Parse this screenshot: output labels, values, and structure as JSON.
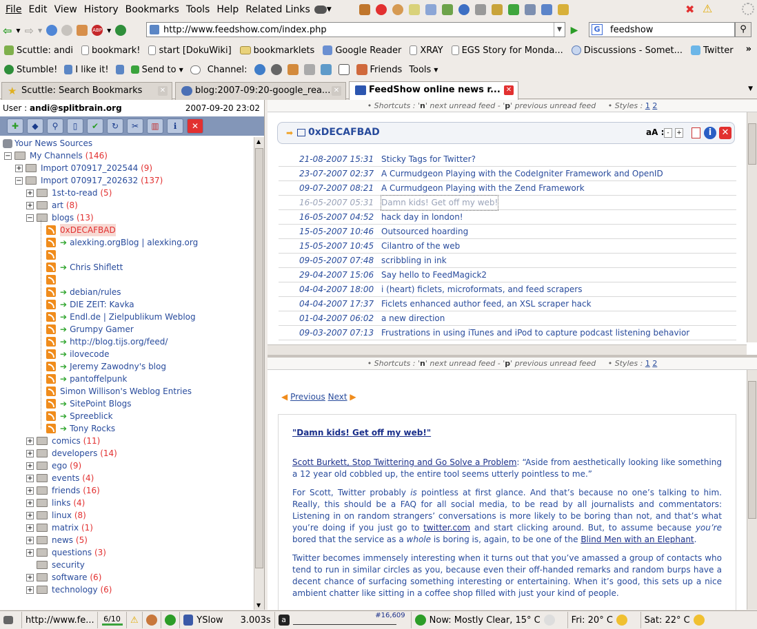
{
  "menu": [
    "File",
    "Edit",
    "View",
    "History",
    "Bookmarks",
    "Tools",
    "Help",
    "Related Links"
  ],
  "nav": {
    "url": "http://www.feedshow.com/index.php",
    "search": "feedshow"
  },
  "bookmarks": [
    "Scuttle: andi",
    "bookmark!",
    "start [DokuWiki]",
    "bookmarklets",
    "Google Reader",
    "XRAY",
    "EGS Story for Monda...",
    "Discussions - Somet...",
    "Twitter"
  ],
  "stumble": {
    "stumble": "Stumble!",
    "like": "I like it!",
    "send": "Send to",
    "channel": "Channel:",
    "friends": "Friends",
    "tools": "Tools"
  },
  "tabs": [
    "Scuttle: Search Bookmarks",
    "blog:2007-09:20-google_rea...",
    "FeedShow online news r..."
  ],
  "user": {
    "label": "User :",
    "name": "andi@splitbrain.org",
    "date": "2007-09-20 23:02"
  },
  "tree": {
    "root": "Your News Sources",
    "channels": {
      "name": "My Channels",
      "count": "(146)"
    },
    "imp1": {
      "name": "Import 070917_202544",
      "count": "(9)"
    },
    "imp2": {
      "name": "Import 070917_202632",
      "count": "(137)"
    },
    "first": {
      "name": "1st-to-read",
      "count": "(5)"
    },
    "art": {
      "name": "art",
      "count": "(8)"
    },
    "blogs": {
      "name": "blogs",
      "count": "(13)"
    },
    "feeds": [
      "0xDECAFBAD",
      "alexking.orgBlog | alexking.org",
      "",
      "Chris Shiflett",
      "",
      "debian/rules",
      "DIE ZEIT: Kavka",
      "Endl.de | Zielpublikum Weblog",
      "Grumpy Gamer",
      "http://blog.tijs.org/feed/",
      "ilovecode",
      "Jeremy Zawodny's blog",
      "pantoffelpunk",
      "Simon Willison's Weblog Entries",
      "SitePoint Blogs",
      "Spreeblick",
      "Tony Rocks"
    ],
    "folders": [
      {
        "name": "comics",
        "count": "(11)"
      },
      {
        "name": "developers",
        "count": "(14)"
      },
      {
        "name": "ego",
        "count": "(9)"
      },
      {
        "name": "events",
        "count": "(4)"
      },
      {
        "name": "friends",
        "count": "(16)"
      },
      {
        "name": "links",
        "count": "(4)"
      },
      {
        "name": "linux",
        "count": "(8)"
      },
      {
        "name": "matrix",
        "count": "(1)"
      },
      {
        "name": "news",
        "count": "(5)"
      },
      {
        "name": "questions",
        "count": "(3)"
      },
      {
        "name": "security",
        "count": ""
      },
      {
        "name": "software",
        "count": "(6)"
      },
      {
        "name": "technology",
        "count": "(6)"
      }
    ]
  },
  "shortcuts": {
    "pre": "• Shortcuts : '",
    "n": "n",
    "mid1": "' next unread feed - '",
    "p": "p",
    "mid2": "' previous unread feed",
    "styles": "• Styles :",
    "s1": "1",
    "s2": "2"
  },
  "feed": {
    "title": "0xDECAFBAD",
    "aa": "aA :",
    "minus": "-",
    "plus": "+"
  },
  "items": [
    {
      "date": "21-08-2007 15:31",
      "title": "Sticky Tags for Twitter?"
    },
    {
      "date": "23-07-2007 02:37",
      "title": "A Curmudgeon Playing with the CodeIgniter Framework and OpenID"
    },
    {
      "date": "09-07-2007 08:21",
      "title": "A Curmudgeon Playing with the Zend Framework"
    },
    {
      "date": "16-05-2007 05:31",
      "title": "Damn kids! Get off my web!"
    },
    {
      "date": "16-05-2007 04:52",
      "title": "hack day in london!"
    },
    {
      "date": "15-05-2007 10:46",
      "title": "Outsourced hoarding"
    },
    {
      "date": "15-05-2007 10:45",
      "title": "Cilantro of the web"
    },
    {
      "date": "09-05-2007 07:48",
      "title": "scribbling in ink"
    },
    {
      "date": "29-04-2007 15:06",
      "title": "Say hello to FeedMagick2"
    },
    {
      "date": "04-04-2007 18:00",
      "title": "i (heart) ficlets, microformats, and feed scrapers"
    },
    {
      "date": "04-04-2007 17:37",
      "title": "Ficlets enhanced author feed, an XSL scraper hack"
    },
    {
      "date": "01-04-2007 06:02",
      "title": "a new direction"
    },
    {
      "date": "09-03-2007 07:13",
      "title": "Frustrations in using iTunes and iPod to capture podcast listening behavior"
    }
  ],
  "article": {
    "prev": "Previous",
    "next": "Next",
    "title": "\"Damn kids! Get off my web!\"",
    "p1link": "Scott Burkett, Stop Twittering and Go Solve a Problem",
    "p1": ": “Aside from aesthetically looking like something a 12 year old cobbled up, the entire tool seems utterly pointless to me.”",
    "p2a": "For Scott, Twitter probably ",
    "p2is": "is",
    "p2b": " pointless at first glance. And that’s because no one’s talking to him. Really, this should be a FAQ for all social media, to be read by all journalists and commentators: Listening in on random strangers’ conversations is more likely to be boring than not, and that’s what you’re doing if you just go to ",
    "p2link": "twitter.com",
    "p2c": " and start clicking around. But, to assume because ",
    "p2you": "you’re",
    "p2d": " bored that the service as a ",
    "p2whole": "whole",
    "p2e": " is boring is, again, to be one of the ",
    "p2link2": "Blind Men with an Elephant",
    "p2f": ".",
    "p3": "Twitter becomes immensely interesting when it turns out that you’ve amassed a group of contacts who tend to run in similar circles as you, because even their off-handed remarks and random burps have a decent chance of surfacing something interesting or entertaining. When it’s good, this sets up a nice ambient chatter like sitting in a coffee shop filled with just your kind of people."
  },
  "status": {
    "url": "http://www.fe...",
    "count": "6/10",
    "yslow": "YSlow",
    "time": "3.003s",
    "rank": "#16,609",
    "weather": "Now: Mostly Clear, 15° C",
    "fri": "Fri: 20° C",
    "sat": "Sat: 22° C"
  }
}
